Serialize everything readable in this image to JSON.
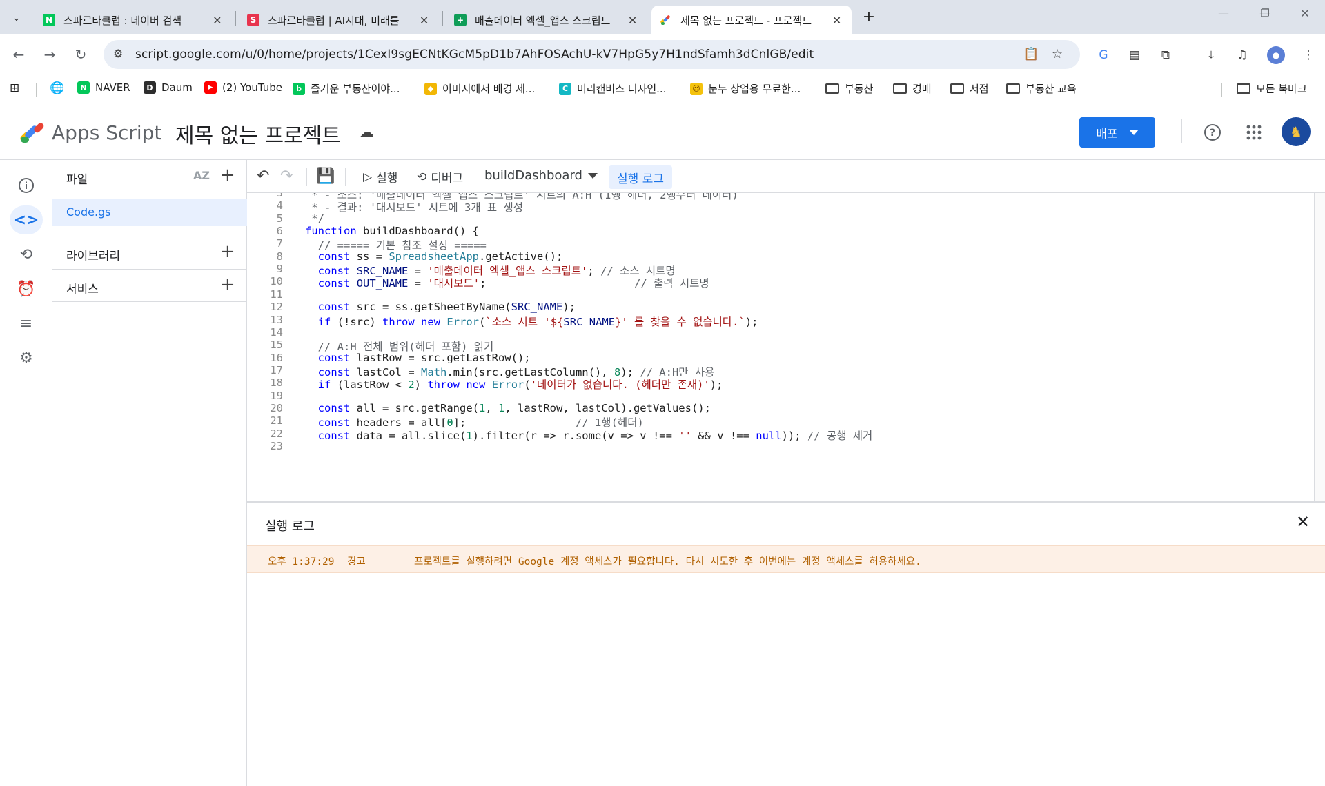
{
  "browser": {
    "tabs": [
      {
        "title": "스파르타클럽 : 네이버 검색",
        "favicon": "naver-icon",
        "color": "#03c75a",
        "glyph": "N"
      },
      {
        "title": "스파르타클럽 | AI시대, 미래를",
        "favicon": "sparta-icon",
        "color": "#e8344e",
        "glyph": "S"
      },
      {
        "title": "매출데이터 엑셀_앱스 스크립트",
        "favicon": "sheets-icon",
        "color": "#0f9d58",
        "glyph": "+"
      },
      {
        "title": "제목 없는 프로젝트 - 프로젝트",
        "favicon": "apps-script-icon",
        "color": "#f4b400",
        "glyph": ""
      }
    ],
    "url": "script.google.com/u/0/home/projects/1CexI9sgECNtKGcM5pD1b7AhFOSAchU-kV7HpG5y7H1ndSfamh3dCnlGB/edit",
    "bookmarks": [
      {
        "label": "NAVER",
        "icon": "naver-icon",
        "color": "#03c75a",
        "glyph": "N"
      },
      {
        "label": "Daum",
        "icon": "daum-icon",
        "color": "#2d2d2d",
        "glyph": "D"
      },
      {
        "label": "(2) YouTube",
        "icon": "youtube-icon",
        "color": "#ff0000",
        "glyph": "▶"
      },
      {
        "label": "즐거운 부동산이야...",
        "icon": "blog-icon",
        "color": "#03c75a",
        "glyph": "b"
      },
      {
        "label": "이미지에서 배경 제...",
        "icon": "remove-bg-icon",
        "color": "#f2b705",
        "glyph": "◆"
      },
      {
        "label": "미리캔버스 디자인...",
        "icon": "miricanvas-icon",
        "color": "#14b8c4",
        "glyph": "C"
      },
      {
        "label": "눈누 상업용 무료한...",
        "icon": "noonnu-icon",
        "color": "#f4c20d",
        "glyph": "☺"
      },
      {
        "label": "부동산",
        "icon": "folder-icon"
      },
      {
        "label": "경매",
        "icon": "folder-icon"
      },
      {
        "label": "서점",
        "icon": "folder-icon"
      },
      {
        "label": "부동산 교육",
        "icon": "folder-icon"
      }
    ],
    "all_bookmarks": "모든 북마크"
  },
  "header": {
    "app_name": "Apps Script",
    "project_title": "제목 없는 프로젝트",
    "deploy_label": "배포"
  },
  "files": {
    "title": "파일",
    "sort_label": "AZ",
    "items": [
      "Code.gs"
    ],
    "libraries": "라이브러리",
    "services": "서비스"
  },
  "toolbar": {
    "run_label": "실행",
    "debug_label": "디버그",
    "function_name": "buildDashboard",
    "log_label": "실행 로그"
  },
  "editor": {
    "lines": [
      {
        "n": "3",
        "html": "<span class=\"cm\"> * - 소스: '매출데이터 엑셀_앱스 스크립트' 시트의 A:H (1행 헤더, 2행부터 데이터)</span>"
      },
      {
        "n": "4",
        "html": "<span class=\"cm\"> * - 결과: '대시보드' 시트에 3개 표 생성</span>"
      },
      {
        "n": "5",
        "html": "<span class=\"cm\"> */</span>"
      },
      {
        "n": "6",
        "html": "<span class=\"kw\">function</span> buildDashboard() {"
      },
      {
        "n": "7",
        "html": "  <span class=\"cm\">// ===== 기본 참조 설정 =====</span>"
      },
      {
        "n": "8",
        "html": "  <span class=\"kw\">const</span> ss = <span class=\"ty\">SpreadsheetApp</span>.getActive();"
      },
      {
        "n": "9",
        "html": "  <span class=\"kw\">const</span> <span class=\"prop\">SRC_NAME</span> = <span class=\"str\">'매출데이터 엑셀_앱스 스크립트'</span>; <span class=\"cm\">// 소스 시트명</span>"
      },
      {
        "n": "10",
        "html": "  <span class=\"kw\">const</span> <span class=\"prop\">OUT_NAME</span> = <span class=\"str\">'대시보드'</span>;                       <span class=\"cm\">// 출력 시트명</span>"
      },
      {
        "n": "11",
        "html": ""
      },
      {
        "n": "12",
        "html": "  <span class=\"kw\">const</span> src = ss.getSheetByName(<span class=\"prop\">SRC_NAME</span>);"
      },
      {
        "n": "13",
        "html": "  <span class=\"kw\">if</span> (!src) <span class=\"kw\">throw</span> <span class=\"kw\">new</span> <span class=\"ty\">Error</span>(<span class=\"str\">`소스 시트 '${</span><span class=\"prop\">SRC_NAME</span><span class=\"str\">}' 를 찾을 수 없습니다.`</span>);"
      },
      {
        "n": "14",
        "html": ""
      },
      {
        "n": "15",
        "html": "  <span class=\"cm\">// A:H 전체 범위(헤더 포함) 읽기</span>"
      },
      {
        "n": "16",
        "html": "  <span class=\"kw\">const</span> lastRow = src.getLastRow();"
      },
      {
        "n": "17",
        "html": "  <span class=\"kw\">const</span> lastCol = <span class=\"ty\">Math</span>.min(src.getLastColumn(), <span class=\"num\">8</span>); <span class=\"cm\">// A:H만 사용</span>"
      },
      {
        "n": "18",
        "html": "  <span class=\"kw\">if</span> (lastRow &lt; <span class=\"num\">2</span>) <span class=\"kw\">throw</span> <span class=\"kw\">new</span> <span class=\"ty\">Error</span>(<span class=\"str\">'데이터가 없습니다. (헤더만 존재)'</span>);"
      },
      {
        "n": "19",
        "html": ""
      },
      {
        "n": "20",
        "html": "  <span class=\"kw\">const</span> all = src.getRange(<span class=\"num\">1</span>, <span class=\"num\">1</span>, lastRow, lastCol).getValues();"
      },
      {
        "n": "21",
        "html": "  <span class=\"kw\">const</span> headers = all[<span class=\"num\">0</span>];                 <span class=\"cm\">// 1행(헤더)</span>"
      },
      {
        "n": "22",
        "html": "  <span class=\"kw\">const</span> data = all.slice(<span class=\"num\">1</span>).filter(r =&gt; r.some(v =&gt; v !== <span class=\"str\">''</span> &amp;&amp; v !== <span class=\"kw\">null</span>)); <span class=\"cm\">// 공행 제거</span>"
      },
      {
        "n": "23",
        "html": ""
      }
    ]
  },
  "log": {
    "title": "실행 로그",
    "entries": [
      {
        "time": "오후 1:37:29",
        "level": "경고",
        "message": "프로젝트를 실행하려면 Google 계정 액세스가 필요합니다. 다시 시도한 후 이번에는 계정 액세스를 허용하세요."
      }
    ]
  },
  "colors": {
    "accent": "#1a73e8",
    "warning_bg": "#fdf0e6",
    "warning_text": "#b06000"
  }
}
